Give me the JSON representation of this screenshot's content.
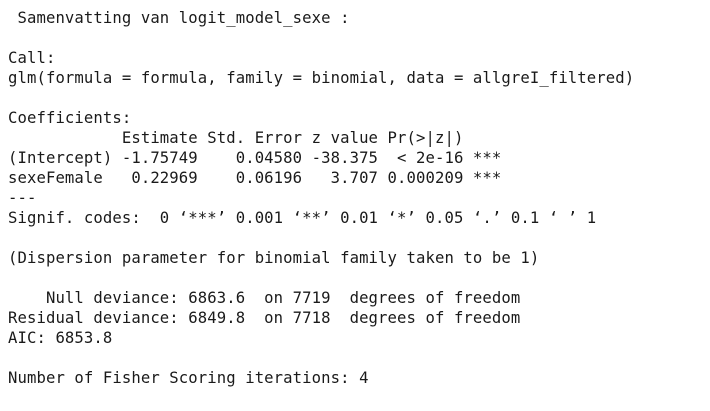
{
  "console": {
    "summary_title": " Samenvatting van logit_model_sexe :",
    "call_header": "Call:",
    "call_text": "glm(formula = formula, family = binomial, data = allgreI_filtered)",
    "coefficients_header": "Coefficients:",
    "coef_table": {
      "header_row": "            Estimate Std. Error z value Pr(>|z|)    ",
      "rows": [
        "(Intercept) -1.75749    0.04580 -38.375  < 2e-16 ***",
        "sexeFemale   0.22969    0.06196   3.707 0.000209 ***"
      ]
    },
    "separator": "---",
    "signif_codes": "Signif. codes:  0 ‘***’ 0.001 ‘**’ 0.01 ‘*’ 0.05 ‘.’ 0.1 ‘ ’ 1",
    "dispersion_note": "(Dispersion parameter for binomial family taken to be 1)",
    "null_deviance": "    Null deviance: 6863.6  on 7719  degrees of freedom",
    "residual_deviance": "Residual deviance: 6849.8  on 7718  degrees of freedom",
    "aic": "AIC: 6853.8",
    "fisher_iterations": "Number of Fisher Scoring iterations: 4"
  }
}
